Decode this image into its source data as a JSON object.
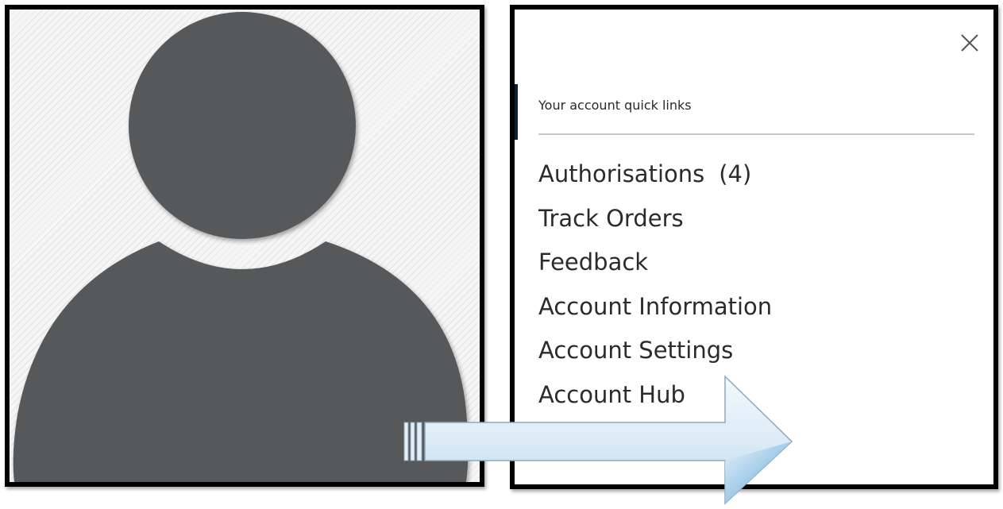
{
  "account_panel": {
    "heading": "Your account quick links",
    "close_icon": "close-icon",
    "links": [
      {
        "label": "Authorisations",
        "count": "(4)"
      },
      {
        "label": "Track Orders",
        "count": ""
      },
      {
        "label": "Feedback",
        "count": ""
      },
      {
        "label": "Account Information",
        "count": ""
      },
      {
        "label": "Account Settings",
        "count": ""
      },
      {
        "label": "Account Hub",
        "count": ""
      }
    ]
  },
  "avatar": {
    "icon": "user-silhouette-icon",
    "color": "#56595a"
  },
  "arrow": {
    "icon": "arrow-right-icon",
    "color": "#d6e8f5"
  }
}
